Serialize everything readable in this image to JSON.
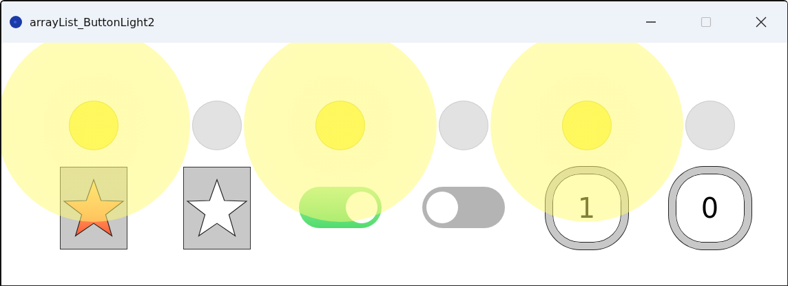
{
  "window": {
    "title": "arrayList_ButtonLight2"
  },
  "buttons": [
    {
      "kind": "star",
      "on": true
    },
    {
      "kind": "star",
      "on": false
    },
    {
      "kind": "toggle",
      "on": true
    },
    {
      "kind": "toggle",
      "on": false
    },
    {
      "kind": "counter",
      "on": true,
      "label": "1"
    },
    {
      "kind": "counter",
      "on": false,
      "label": "0"
    }
  ]
}
